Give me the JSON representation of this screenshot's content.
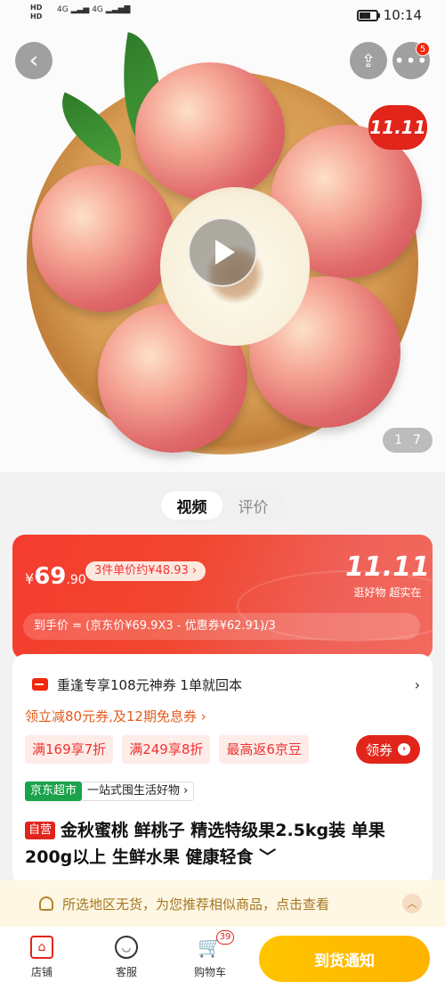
{
  "status_bar": {
    "hd_top": "HD",
    "hd_bottom": "HD",
    "net1": "4G",
    "net2": "4G",
    "time": "10:14"
  },
  "header": {
    "more_badge": "5",
    "promo_badge": "11.11"
  },
  "gallery": {
    "page_current": "1",
    "page_total": "7"
  },
  "tabs": [
    {
      "label": "视频",
      "active": true
    },
    {
      "label": "评价",
      "active": false
    }
  ],
  "price": {
    "currency": "¥",
    "integer": "69",
    "decimal": ".90",
    "unit_tag": "3件单价约¥48.93 ›",
    "event_logo": "11.11",
    "event_slogan": "逛好物 超实在",
    "calc_text": "到手价 = (京东价¥69.9X3 - 优惠券¥62.91)/3"
  },
  "coupon": {
    "text": "重逢专享108元神券 1单就回本",
    "chevron": "›"
  },
  "promo_line": "领立减80元券,及12期免息券 ›",
  "chips": [
    "满169享7折",
    "满249享8折",
    "最高返6京豆"
  ],
  "get_coupon_label": "领券",
  "market": {
    "tag": "京东超市",
    "desc": "一站式囤生活好物 ›"
  },
  "product": {
    "self_tag": "自营",
    "title": "金秋蜜桃 鲜桃子 精选特级果2.5kg装 单果200g以上 生鲜水果 健康轻食 ﹀"
  },
  "notice": {
    "text": "所选地区无货，为您推荐相似商品，点击查看"
  },
  "bottom_bar": {
    "store_label": "店铺",
    "service_label": "客服",
    "cart_label": "购物车",
    "cart_count": "39",
    "notify_label": "到货通知"
  },
  "colors": {
    "accent_red": "#e1251b",
    "notify_yellow": "#ffb400"
  }
}
